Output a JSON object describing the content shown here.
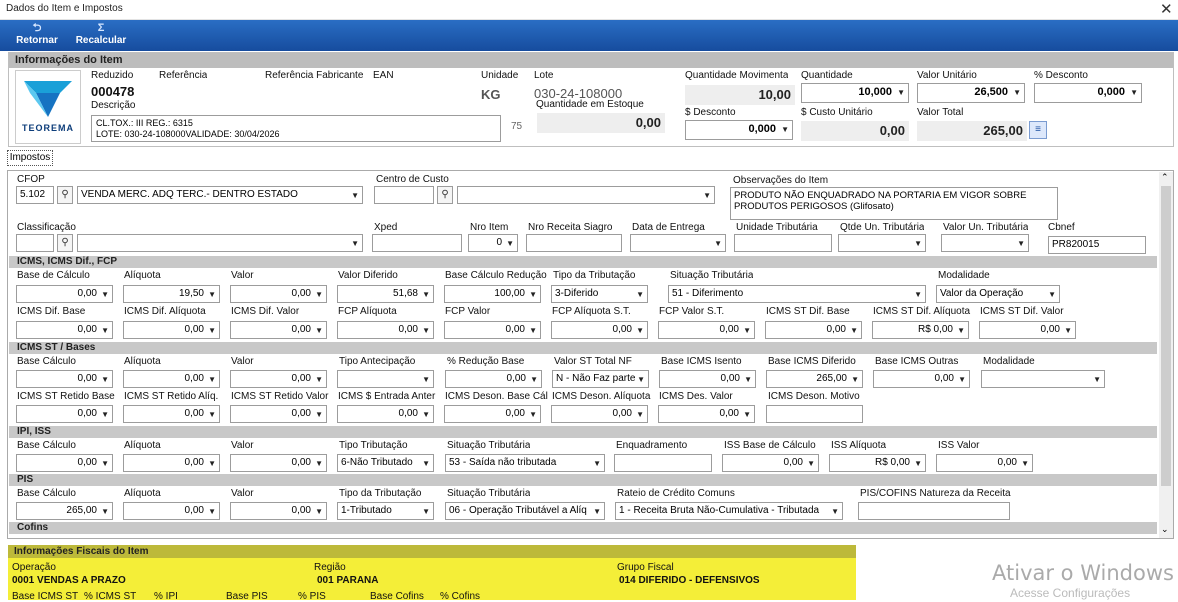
{
  "window": {
    "title": "Dados do Item e Impostos",
    "close": "✕"
  },
  "toolbar": {
    "retornar": "Retornar",
    "recalcular": "Recalcular"
  },
  "info": {
    "title": "Informações do Item",
    "reduzido_lbl": "Reduzido",
    "reduzido": "000478",
    "referencia_lbl": "Referência",
    "ref_fab_lbl": "Referência Fabricante",
    "ean_lbl": "EAN",
    "descricao_lbl": "Descrição",
    "descricao_l1": "CL.TOX.: III REG.: 6315",
    "descricao_l2": "LOTE: 030-24-108000VALIDADE: 30/04/2026",
    "desc_num": "75",
    "unidade_lbl": "Unidade",
    "unidade": "KG",
    "lote_lbl": "Lote",
    "lote": "030-24-108000",
    "qtd_estoque_lbl": "Quantidade em Estoque",
    "qtd_estoque": "0,00",
    "qtd_mov_lbl": "Quantidade Movimenta",
    "qtd_mov": "10,00",
    "quantidade_lbl": "Quantidade",
    "quantidade": "10,000",
    "valor_unit_lbl": "Valor Unitário",
    "valor_unit": "26,500",
    "pct_desc_lbl": "% Desconto",
    "pct_desc": "0,000",
    "desc_lbl": "$ Desconto",
    "desc": "0,000",
    "custo_lbl": "$ Custo Unitário",
    "custo": "0,00",
    "total_lbl": "Valor Total",
    "total": "265,00",
    "logo": "TEOREMA"
  },
  "tab": "Impostos",
  "form": {
    "cfop_lbl": "CFOP",
    "cfop": "5.102",
    "cfop_desc": "VENDA MERC. ADQ TERC.- DENTRO ESTADO",
    "centro_lbl": "Centro de Custo",
    "obs_lbl": "Observações do Item",
    "obs": "PRODUTO NÃO ENQUADRADO NA PORTARIA EM VIGOR SOBRE PRODUTOS PERIGOSOS (Glifosato)",
    "classif_lbl": "Classificação",
    "xped_lbl": "Xped",
    "nro_item_lbl": "Nro Item",
    "nro_item": "0",
    "nro_rec_lbl": "Nro Receita Siagro",
    "data_ent_lbl": "Data de Entrega",
    "un_trib_lbl": "Unidade Tributária",
    "qtde_un_lbl": "Qtde Un. Tributária",
    "valor_un_lbl": "Valor Un. Tributária",
    "cbnef_lbl": "Cbnef",
    "cbnef": "PR820015"
  },
  "icms": {
    "title": "ICMS, ICMS Dif., FCP",
    "row1": [
      {
        "l": "Base de Cálculo",
        "v": "0,00"
      },
      {
        "l": "Alíquota",
        "v": "19,50"
      },
      {
        "l": "Valor",
        "v": "0,00"
      },
      {
        "l": "Valor Diferido",
        "v": "51,68"
      },
      {
        "l": "Base Cálculo Redução",
        "v": "100,00"
      }
    ],
    "tipo_trib_lbl": "Tipo da Tributação",
    "tipo_trib": "3-Diferido",
    "sit_trib_lbl": "Situação Tributária",
    "sit_trib": "51 - Diferimento",
    "modal_lbl": "Modalidade",
    "modal": "Valor da Operação",
    "row2": [
      {
        "l": "ICMS Dif. Base",
        "v": "0,00"
      },
      {
        "l": "ICMS Dif. Alíquota",
        "v": "0,00"
      },
      {
        "l": "ICMS Dif. Valor",
        "v": "0,00"
      },
      {
        "l": "FCP Alíquota",
        "v": "0,00"
      },
      {
        "l": "FCP Valor",
        "v": "0,00"
      },
      {
        "l": "FCP Alíquota S.T.",
        "v": "0,00"
      },
      {
        "l": "FCP Valor S.T.",
        "v": "0,00"
      },
      {
        "l": "ICMS ST Dif. Base",
        "v": "0,00"
      },
      {
        "l": "ICMS ST Dif. Alíquota",
        "v": "R$ 0,00"
      },
      {
        "l": "ICMS ST Dif. Valor",
        "v": "0,00"
      }
    ]
  },
  "icmsst": {
    "title": "ICMS ST / Bases",
    "row1": [
      {
        "l": "Base Cálculo",
        "v": "0,00"
      },
      {
        "l": "Alíquota",
        "v": "0,00"
      },
      {
        "l": "Valor",
        "v": "0,00"
      }
    ],
    "tipo_ant_lbl": "Tipo Antecipação",
    "red_base_lbl": "% Redução Base",
    "red_base": "0,00",
    "vst_lbl": "Valor ST Total NF",
    "vst": "N - Não Faz parte",
    "bisento_lbl": "Base ICMS Isento",
    "bisento": "0,00",
    "bdif_lbl": "Base ICMS Diferido",
    "bdif": "265,00",
    "boutras_lbl": "Base ICMS Outras",
    "boutras": "0,00",
    "modal_lbl": "Modalidade",
    "row2": [
      {
        "l": "ICMS ST Retido Base",
        "v": "0,00"
      },
      {
        "l": "ICMS ST Retido Alíq.",
        "v": "0,00"
      },
      {
        "l": "ICMS ST Retido Valor",
        "v": "0,00"
      },
      {
        "l": "ICMS $ Entrada Anter",
        "v": "0,00"
      },
      {
        "l": "ICMS Deson. Base Cál",
        "v": "0,00"
      },
      {
        "l": "ICMS Deson. Alíquota",
        "v": "0,00"
      },
      {
        "l": "ICMS Des. Valor",
        "v": "0,00"
      }
    ],
    "motivo_lbl": "ICMS Deson. Motivo"
  },
  "ipi": {
    "title": "IPI, ISS",
    "row": [
      {
        "l": "Base Cálculo",
        "v": "0,00"
      },
      {
        "l": "Alíquota",
        "v": "0,00"
      },
      {
        "l": "Valor",
        "v": "0,00"
      }
    ],
    "tipo_lbl": "Tipo Tributação",
    "tipo": "6-Não Tributado",
    "sit_lbl": "Situação Tributária",
    "sit": "53 - Saída não tributada",
    "enq_lbl": "Enquadramento",
    "iss_base_lbl": "ISS Base de Cálculo",
    "iss_base": "0,00",
    "iss_aliq_lbl": "ISS Alíquota",
    "iss_aliq": "R$ 0,00",
    "iss_valor_lbl": "ISS Valor",
    "iss_valor": "0,00"
  },
  "pis": {
    "title": "PIS",
    "row": [
      {
        "l": "Base Cálculo",
        "v": "265,00"
      },
      {
        "l": "Alíquota",
        "v": "0,00"
      },
      {
        "l": "Valor",
        "v": "0,00"
      }
    ],
    "tipo_lbl": "Tipo da Tributação",
    "tipo": "1-Tributado",
    "sit_lbl": "Situação Tributária",
    "sit": "06 - Operação Tributável a Alíq",
    "rateio_lbl": "Rateio de Crédito Comuns",
    "rateio": "1 - Receita Bruta Não-Cumulativa - Tributada",
    "nat_lbl": "PIS/COFINS Natureza da Receita"
  },
  "cofins": {
    "title": "Cofins"
  },
  "fiscal": {
    "title": "Informações Fiscais do Item",
    "oper_lbl": "Operação",
    "oper": "0001  VENDAS A PRAZO",
    "regiao_lbl": "Região",
    "regiao": "001   PARANA",
    "grupo_lbl": "Grupo Fiscal",
    "grupo": "014   DIFERIDO - DEFENSIVOS",
    "cut": [
      "Base ICMS ST",
      "% ICMS ST",
      "% IPI",
      "Base PIS",
      "% PIS",
      "Base Cofins",
      "% Cofins"
    ]
  },
  "watermark": {
    "l1": "Ativar o Windows",
    "l2": "Acesse Configurações"
  }
}
